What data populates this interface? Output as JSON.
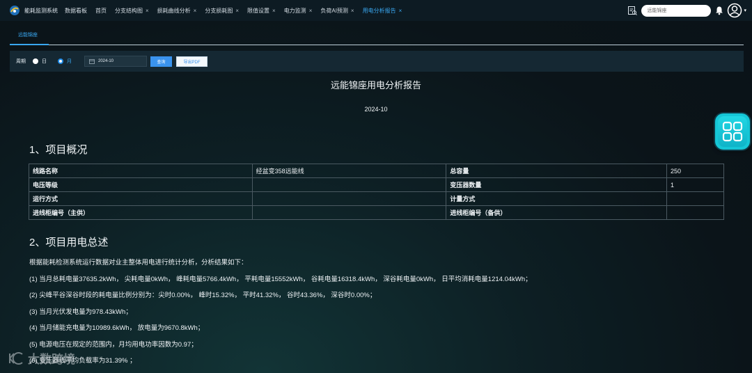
{
  "header": {
    "app_title": "能耗监测系统",
    "nav": [
      {
        "label": "数据看板",
        "closable": false
      },
      {
        "label": "首页",
        "closable": false
      },
      {
        "label": "分支结构图",
        "closable": true
      },
      {
        "label": "损耗曲线分析",
        "closable": true
      },
      {
        "label": "分支损耗图",
        "closable": true
      },
      {
        "label": "限值设置",
        "closable": true
      },
      {
        "label": "电力监测",
        "closable": true
      },
      {
        "label": "负荷AI预测",
        "closable": true
      },
      {
        "label": "用电分析报告",
        "closable": true,
        "active": true
      }
    ],
    "close_glyph": "×",
    "search_placeholder": "远能锦座",
    "caret": "▾"
  },
  "subtab": {
    "label": "远能锦座"
  },
  "filter": {
    "period_label": "周期",
    "options": [
      "日",
      "月"
    ],
    "selected": "月",
    "date_value": "2024-10",
    "query_label": "查询",
    "export_label": "导出PDF"
  },
  "report": {
    "title": "远能锦座用电分析报告",
    "date": "2024-10",
    "section1_title": "1、项目概况",
    "table": [
      [
        "线路名称",
        "经盆变358远能线",
        "总容量",
        "250"
      ],
      [
        "电压等级",
        "",
        "变压器数量",
        "1"
      ],
      [
        "运行方式",
        "",
        "计量方式",
        ""
      ],
      [
        "进线柜编号（主供）",
        "",
        "进线柜编号（备供）",
        ""
      ]
    ],
    "section2_title": "2、项目用电总述",
    "paragraphs": [
      "根据能耗检测系统运行数据对业主整体用电进行统计分析，分析结果如下：",
      "(1) 当月总耗电量37635.2kWh， 尖耗电量0kWh， 峰耗电量5766.4kWh， 平耗电量15552kWh， 谷耗电量16318.4kWh， 深谷耗电量0kWh， 日平均消耗电量1214.04kWh；",
      "(2) 尖峰平谷深谷时段的耗电量比例分别为：尖时0.00%， 峰时15.32%， 平时41.32%， 谷时43.36%， 深谷时0.00%；",
      "(3) 当月光伏发电量为978.43kWh；",
      "(4) 当月储能充电量为10989.6kWh， 放电量为9670.8kWh；",
      "(5) 电源电压在规定的范围内，月均用电功率因数为0.97；",
      "(6) 变压器线平均负载率为31.39% ；"
    ]
  },
  "watermark": "大数跨境",
  "colors": {
    "accent": "#39a7f0",
    "float_button": "#15c6d6",
    "query_button": "#3a93ee"
  }
}
